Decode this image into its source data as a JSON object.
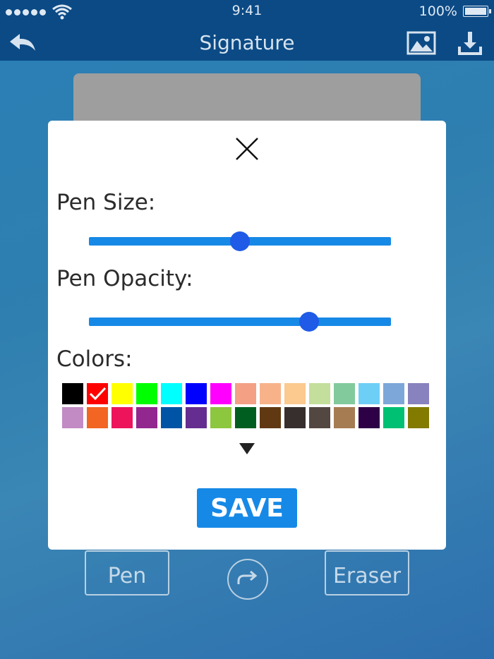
{
  "status_bar": {
    "time": "9:41",
    "battery": "100%"
  },
  "nav": {
    "title": "Signature"
  },
  "toolbar": {
    "pen_label": "Pen",
    "eraser_label": "Eraser"
  },
  "modal": {
    "pen_size_label": "Pen Size:",
    "pen_size_value": 0.5,
    "pen_opacity_label": "Pen Opacity:",
    "pen_opacity_value": 0.73,
    "colors_label": "Colors:",
    "selected_color_index": 1,
    "save_label": "SAVE",
    "colors": [
      "#000000",
      "#ff0000",
      "#ffff00",
      "#00ff00",
      "#00ffff",
      "#0000ff",
      "#ff00ff",
      "#f4a085",
      "#f8b28a",
      "#fcc98f",
      "#c4df9b",
      "#82ca9c",
      "#6dcff6",
      "#7da7d9",
      "#8882be",
      "#c28bc4",
      "#f26522",
      "#ed145b",
      "#92278f",
      "#0054a6",
      "#662d91",
      "#8dc63f",
      "#005e20",
      "#603913",
      "#362f2d",
      "#534741",
      "#a67c52",
      "#2e0146",
      "#00c073",
      "#827b00"
    ]
  },
  "icons": {
    "back": "reply-arrow-icon",
    "image": "image-icon",
    "download": "download-icon",
    "close": "close-icon",
    "expand": "triangle-down-icon",
    "redo": "redo-icon"
  }
}
